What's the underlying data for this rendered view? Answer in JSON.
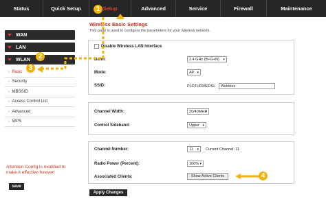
{
  "nav": {
    "tabs": [
      {
        "label": "Status"
      },
      {
        "label": "Quick Setup"
      },
      {
        "label": "Setup"
      },
      {
        "label": "Advanced"
      },
      {
        "label": "Service"
      },
      {
        "label": "Firewall"
      },
      {
        "label": "Maintenance"
      }
    ]
  },
  "sidebar": {
    "sections": [
      "WAN",
      "LAN",
      "WLAN"
    ],
    "items": [
      "Basic",
      "Security",
      "MBSSID",
      "Access Control List",
      "Advanced",
      "WPS"
    ]
  },
  "attention": {
    "text": "Attention Config is modified to make it effective forever!",
    "save_label": "save"
  },
  "page": {
    "title": "Wireless Basic Settings",
    "description": "This page is used to configure the parameters for your wireless network."
  },
  "form": {
    "disable_label": "Disable Wireless LAN Interface",
    "band_label": "Band:",
    "band_value": "2.4 GHz (B+G+N)",
    "mode_label": "Mode:",
    "mode_value": "AP",
    "ssid_label": "SSID:",
    "ssid_prefix": "PLDTHOMEDSL",
    "ssid_value": "Webbies",
    "channel_width_label": "Channel Width:",
    "channel_width_value": "20/40MHZ",
    "sideband_label": "Control Sideband:",
    "sideband_value": "Upper",
    "channel_number_label": "Channel Number:",
    "channel_number_value": "11",
    "current_channel": "Current Channel: 11",
    "radio_power_label": "Radio Power (Percent):",
    "radio_power_value": "100%",
    "clients_label": "Associated Clients:",
    "clients_button": "Show Active Clients",
    "apply_label": "Apply Changes"
  },
  "annotations": {
    "badge1": "1",
    "badge2": "2",
    "badge3": "3",
    "badge4": "4",
    "color": "#f2b20e"
  },
  "colors": {
    "accent_red": "#c62a1a",
    "nav_bg": "#262626"
  }
}
